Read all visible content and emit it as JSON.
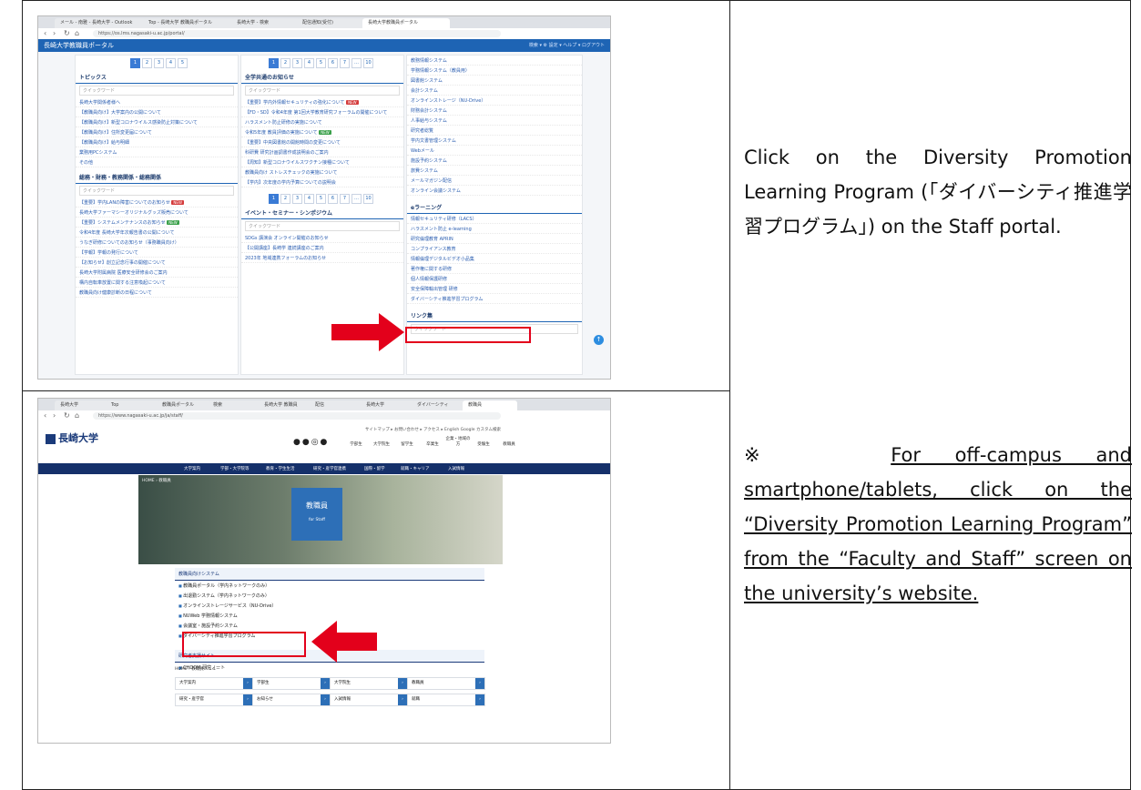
{
  "instructions": {
    "step1": "Click on the Diversity Promotion Learning Program (「ダイバーシティ推進学習プログラム」) on the Staff portal.",
    "step2_mark": "※",
    "step2_text": "For off-campus and smartphone/tablets, click on the “Diversity Promotion Learning Program” from the “Faculty and Staff” screen on the university’s website."
  },
  "shot1": {
    "tabs": [
      "メール - 南雅 - 長崎大学 - Outlook",
      "Top - 長崎大学 教職員ポータル",
      "長崎大学 - 検索",
      "配信通知(受付)",
      "長崎大学教職員ポータル"
    ],
    "url": "https://os.lms.nagasaki-u.ac.jp/portal/",
    "portal_title": "長崎大学教職員ポータル",
    "portal_tools": "検索 ▾   ⚙ 設定 ▾   ヘルプ ▾   ログアウト",
    "left": {
      "pages": [
        "1",
        "2",
        "3",
        "4",
        "5"
      ],
      "topics_title": "トピックス",
      "filter": "クイックワード",
      "topics": [
        "長崎大学関係者様へ",
        "【教職員向け】大学案内の公開について",
        "【教職員向け】新型コロナウイルス感染防止対策について",
        "【教職員向け】住所変更届について",
        "【教職員向け】給与明細",
        "業務用PCシステム",
        "その他"
      ],
      "notices_title": "総務・財務・教務関係・総務関係",
      "notices": [
        "【重要】学内LANの障害についてのお知らせ",
        "長崎大学ファーマシーオリジナルグッズ販売について",
        "【重要】システムメンテナンスのお知らせ",
        "令和4年度 長崎大学年次報告書の公開について",
        "うなぎ研修についてのお知らせ（事務職員向け）",
        "【学報】学報の発行について",
        "【お知らせ】創立記念行事の開催について",
        "長崎大学附属病院 医療安全研修会のご案内",
        "構内自転車放置に関する注意喚起について",
        "教職員向け健康診断の日程について"
      ]
    },
    "mid": {
      "pages": [
        "1",
        "2",
        "3",
        "4",
        "5",
        "6",
        "7",
        "…",
        "10"
      ],
      "news_title": "全学共通のお知らせ",
      "filter": "クイックワード",
      "news": [
        "【重要】学内外情報セキュリティの強化について",
        "【FD・SD】令和4年度 第1回大学教育研究フォーラムの開催について",
        "ハラスメント防止研修の実施について",
        "令和5年度 教員評価の実施について",
        "【重要】中央図書館の開館時間の変更について",
        "科研費 研究計画調書作成説明会のご案内",
        "【周知】新型コロナウイルスワクチン接種について",
        "教職員向け ストレスチェックの実施について",
        "【学内】次年度の学内予算についての説明会"
      ],
      "events_title": "イベント・セミナー・シンポジウム",
      "events": [
        "SDGs 講演会 オンライン開催のお知らせ",
        "【公開講座】長崎学 連続講座のご案内",
        "2023年 地域連携フォーラムのお知らせ"
      ]
    },
    "right": {
      "systems": [
        "教務情報システム",
        "学務情報システム（教員用）",
        "図書館システム",
        "会計システム",
        "オンラインストレージ（NU-Drive）",
        "財務会計システム",
        "人事給与システム",
        "研究者総覧",
        "学内文書管理システム",
        "Webメール",
        "施設予約システム",
        "旅費システム",
        "メールマガジン配信",
        "オンライン会議システム"
      ],
      "elearning_title": "eラーニング",
      "elearning": [
        "情報セキュリティ研修（LACS）",
        "ハラスメント防止 e-learning",
        "研究倫理教育 APRIN",
        "コンプライアンス教育",
        "情報倫理デジタルビデオ小品集",
        "著作権に関する研修",
        "個人情報保護研修",
        "安全保障輸出管理 研修",
        "ダイバーシティ推進学習プログラム"
      ],
      "links_title": "リンク集",
      "filter": "クイックワード"
    }
  },
  "shot2": {
    "tabs": [
      "長崎大学",
      "Top",
      "教職員ポータル",
      "検索",
      "長崎大学 教職員",
      "配信",
      "長崎大学",
      "ダイバーシティ",
      "教職員"
    ],
    "url": "https://www.nagasaki-u.ac.jp/ja/staff/",
    "logo": "長崎大学",
    "top_links": "サイトマップ ▸ お問い合わせ ▸ アクセス ▸ English   Google カスタム検索",
    "quick": [
      "学部生",
      "大学院生",
      "留学生",
      "卒業生",
      "企業・地域の方",
      "受験生",
      "教職員"
    ],
    "nav": [
      "大学案内",
      "学部・大学院等",
      "教育・学生生活",
      "研究・産学官連携",
      "国際・留学",
      "就職・キャリア",
      "入試情報"
    ],
    "breadcrumb": "HOME › 教職員",
    "hero_title": "教職員",
    "hero_sub": "for Staff",
    "sys_title": "教職員向けシステム",
    "systems": [
      "教職員ポータル（学内ネットワークのみ）",
      "出退勤システム（学内ネットワークのみ）",
      "オンラインストレージサービス（NU-Drive）",
      "NUWeb 学務情報システム",
      "会議室・施設予約システム",
      "ダイバーシティ推進学習プログラム"
    ],
    "other_title": "研究者支援サイト",
    "other": [
      "CHOOM 研究ノート"
    ],
    "menu_title": "HOME › 教職員メニュー",
    "tiles": [
      "大学案内",
      "学部生",
      "大学院生",
      "教職員",
      "研究・産学官",
      "お知らせ",
      "入試情報",
      "就職"
    ]
  }
}
